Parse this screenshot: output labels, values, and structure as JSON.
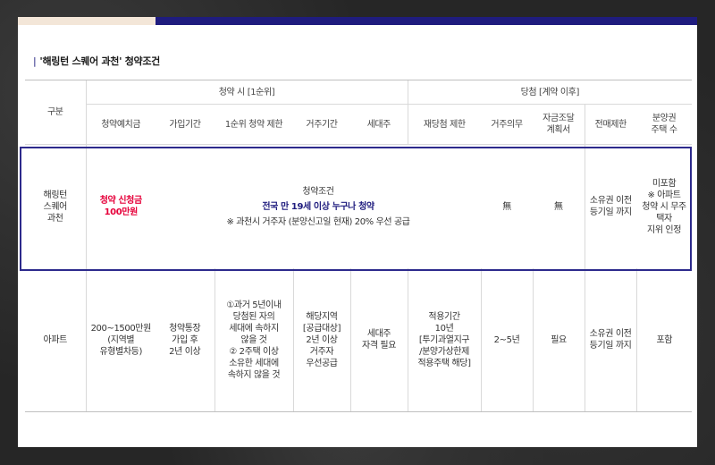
{
  "section": {
    "marker": "|",
    "title": "'해링턴 스퀘어 과천' 청약조건"
  },
  "header": {
    "gubun": "구분",
    "group1": "청약 시 [1순위]",
    "group2": "당첨 [계약 이후]",
    "cols": [
      "청약예치금",
      "가입기간",
      "1순위 청약 제한",
      "거주기간",
      "세대주",
      "재당첨 제한",
      "거주의무",
      "자금조달\n계획서",
      "전매제한",
      "분양권\n주택 수"
    ]
  },
  "featured": {
    "name": "해링턴\n스퀘어\n과천",
    "deposit_l1": "청약 신청금",
    "deposit_l2": "100만원",
    "cond_title": "청약조건",
    "cond_main": "전국  만 19세 이상 누구나 청약",
    "cond_note": "※ 과천시 거주자 (분양신고일 현재) 20% 우선 공급",
    "residence_obligation": "無",
    "funding_plan": "無",
    "resale": "소유권 이전\n등기일 까지",
    "house_count": "미포함\n※ 아파트\n청약 시 무주택자\n지위 인정"
  },
  "apartment": {
    "name": "아파트",
    "deposit": "200~1500만원\n(지역별\n유형별차등)",
    "period": "청약통장\n가입 후\n2년 이상",
    "restriction": "①과거 5년이내\n당첨된 자의\n세대에 속하지\n않을 것\n② 2주택 이상\n소유한 세대에\n속하지 않을 것",
    "residence": "해당지역\n[공급대상]\n2년 이상\n거주자\n우선공급",
    "head": "세대주\n자격 필요",
    "rewin": "적용기간\n10년\n[투기과열지구\n/분양가상한제\n적용주택 해당]",
    "residence_obligation": "2~5년",
    "funding_plan": "필요",
    "resale": "소유권 이전\n등기일 까지",
    "house_count": "포함"
  }
}
